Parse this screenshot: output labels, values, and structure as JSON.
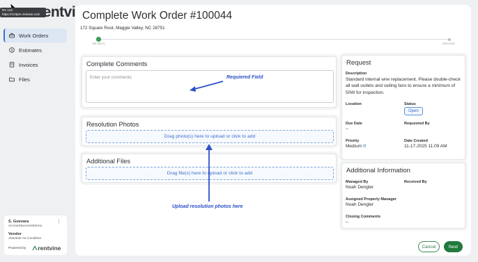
{
  "sidebar": {
    "logo_text": "rentvine",
    "tooltip_line1": "RV 123",
    "tooltip_line2": "https://123pm.rentvine.com",
    "items": [
      {
        "label": "Work Orders",
        "icon": "toolbox-icon",
        "active": true
      },
      {
        "label": "Estimates",
        "icon": "dollar-icon"
      },
      {
        "label": "Invoices",
        "icon": "invoice-icon"
      },
      {
        "label": "Files",
        "icon": "folder-icon"
      }
    ],
    "user": {
      "name": "S. Guevara",
      "account": "AccountSuccessDemo",
      "role": "Vendor",
      "company": "Absolute Air Condition",
      "powered_by": "Powered by",
      "brand": "rentvine"
    }
  },
  "page": {
    "title": "Complete Work Order #100044",
    "address": "172 Square Root, Maggie Valley, NC 28751",
    "steps": [
      "DETAILS",
      "INVOICE"
    ]
  },
  "comments": {
    "title": "Complete Comments",
    "placeholder": "Enter your comments"
  },
  "photos": {
    "title": "Resolution Photos",
    "dropzone": "Drag photo(s) here to upload or click to add"
  },
  "files": {
    "title": "Additional Files",
    "dropzone": "Drag file(s) here to upload or click to add"
  },
  "annotations": {
    "required": "Requiered Field",
    "upload": "Upload resolution photos here",
    "color": "#2c50c8"
  },
  "request": {
    "title": "Request",
    "description_label": "Description",
    "description": "Standard internal wire replacement. Please double-check all wall outlets and ceiling fans to ensure a minimum of 50W for inspection.",
    "location_label": "Location",
    "status_label": "Status",
    "status": "Open",
    "due_label": "Due Date",
    "due": "--",
    "requested_label": "Requested By",
    "priority_label": "Priority",
    "priority": "Medium",
    "priority_mark": "!!",
    "created_label": "Date Created",
    "created": "11-17-2025 11:09 AM"
  },
  "additional_info": {
    "title": "Additional Information",
    "managed_label": "Managed By",
    "managed": "Noah Dengler",
    "received_label": "Received By",
    "assigned_label": "Assigned Property Manager",
    "assigned": "Noah Dengler",
    "closing_label": "Closing Comments",
    "closing": "--"
  },
  "footer": {
    "cancel": "Cancel",
    "next": "Next"
  },
  "colors": {
    "accent_blue": "#3b6fd1",
    "success_green": "#1f7a3d",
    "page_bg": "#eef0f1"
  }
}
